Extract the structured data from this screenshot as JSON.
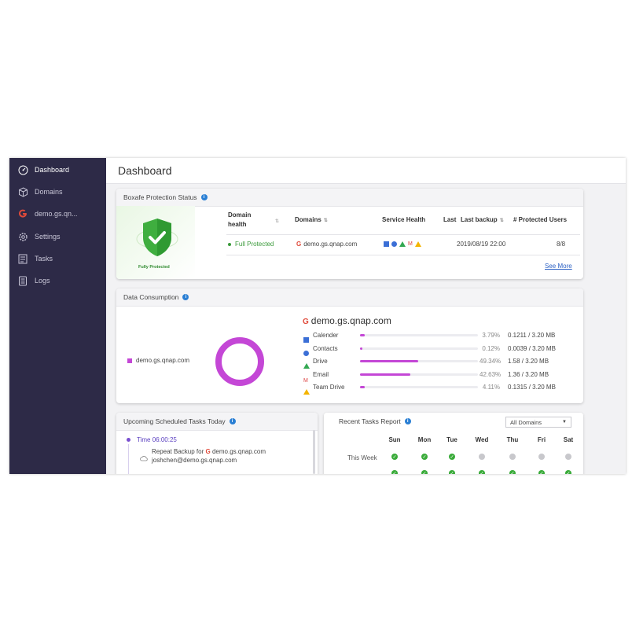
{
  "sidebar": {
    "items": [
      {
        "label": "Dashboard",
        "icon": "dashboard-icon"
      },
      {
        "label": "Domains",
        "icon": "cube-icon"
      },
      {
        "label": "demo.gs.qn...",
        "icon": "google-icon"
      },
      {
        "label": "Settings",
        "icon": "gear-icon"
      },
      {
        "label": "Tasks",
        "icon": "tasks-icon"
      },
      {
        "label": "Logs",
        "icon": "logs-icon"
      }
    ]
  },
  "header": {
    "title": "Dashboard"
  },
  "protection": {
    "title": "Boxafe Protection Status",
    "badge_label": "Fully Protected",
    "columns": {
      "domain_health_1": "Domain",
      "domain_health_2": "health",
      "domains": "Domains",
      "service_health": "Service Health",
      "last": "Last",
      "last_backup": "Last backup",
      "protected_users": "# Protected Users"
    },
    "row": {
      "health": "Full Protected",
      "domain": "demo.gs.qnap.com",
      "last_backup": "2019/08/19 22:00",
      "protected_users": "8/8"
    },
    "see_more": "See More"
  },
  "consumption": {
    "title": "Data Consumption",
    "legend_label": "demo.gs.qnap.com",
    "domain": "demo.gs.qnap.com",
    "services": [
      {
        "name": "Calender",
        "percent": "3.79%",
        "usage": "0.1211 / 3.20 MB",
        "fraction": 0.0379
      },
      {
        "name": "Contacts",
        "percent": "0.12%",
        "usage": "0.0039 / 3.20 MB",
        "fraction": 0.0012
      },
      {
        "name": "Drive",
        "percent": "49.34%",
        "usage": "1.58 / 3.20 MB",
        "fraction": 0.4934
      },
      {
        "name": "Email",
        "percent": "42.63%",
        "usage": "1.36 / 3.20 MB",
        "fraction": 0.4263
      },
      {
        "name": "Team Drive",
        "percent": "4.11%",
        "usage": "0.1315 / 3.20 MB",
        "fraction": 0.0411
      }
    ],
    "accent_color": "#c447d6"
  },
  "scheduled": {
    "title": "Upcoming Scheduled Tasks Today",
    "time": "Time 06:00:25",
    "task_prefix": "Repeat Backup for",
    "task_domain": "demo.gs.qnap.com",
    "task_user": "joshchen@demo.gs.qnap.com"
  },
  "report": {
    "title": "Recent Tasks Report",
    "filter": "All Domains",
    "days": [
      "Sun",
      "Mon",
      "Tue",
      "Wed",
      "Thu",
      "Fri",
      "Sat"
    ],
    "row_label": "This Week",
    "this_week": [
      "ok",
      "ok",
      "ok",
      "none",
      "none",
      "none",
      "none"
    ],
    "next_row": [
      "ok",
      "ok",
      "ok",
      "ok",
      "ok",
      "ok",
      "ok"
    ]
  }
}
